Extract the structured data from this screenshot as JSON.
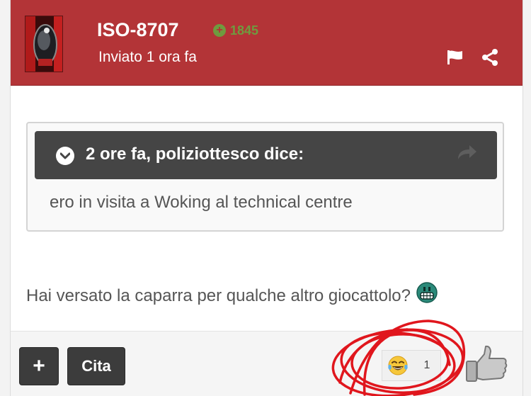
{
  "post": {
    "author": "ISO-8707",
    "reputation": "1845",
    "posted": "Inviato 1 ora fa",
    "message": "Hai versato la caparra per qualche altro giocattolo?"
  },
  "quote": {
    "header": "2 ore fa, poliziottesco dice:",
    "body": "ero in visita a Woking al technical centre"
  },
  "footer": {
    "plus_label": "+",
    "cite_label": "Cita",
    "reaction_count": "1"
  },
  "icons": {
    "reputation": "plus-circle-icon",
    "report": "flag-icon",
    "share": "share-icon",
    "quote_toggle": "chevron-down-icon",
    "quote_link": "share-arrow-icon",
    "emoji_message": "grin-emoji-icon",
    "reaction": "laughing-tears-emoji-icon",
    "like": "thumbs-up-icon"
  },
  "colors": {
    "header_bg": "#b33437",
    "reputation": "#6f9b3f",
    "quote_header_bg": "#454545",
    "button_bg": "#3c3c3c",
    "annotation": "#e0161d"
  }
}
